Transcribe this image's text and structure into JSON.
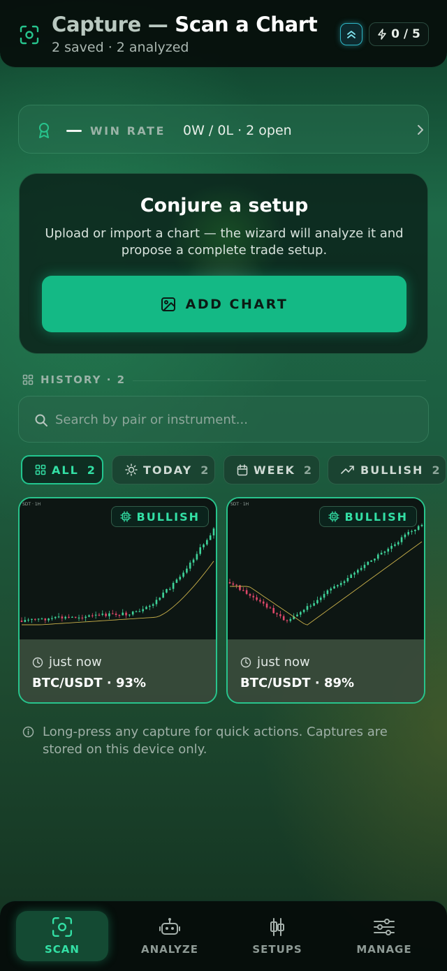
{
  "header": {
    "title_lead": "Capture —",
    "title_main": "Scan a Chart",
    "subtitle": "2 saved · 2 analyzed",
    "credits": "0 / 5",
    "icons": [
      "scan-icon",
      "rank-chevrons-icon",
      "bolt-icon"
    ]
  },
  "winrate": {
    "label": "WIN RATE",
    "value": "0W / 0L · 2 open",
    "icons": [
      "award-icon",
      "chevron-right-icon"
    ]
  },
  "hero": {
    "title": "Conjure a setup",
    "description": "Upload or import a chart — the wizard will analyze it and propose a complete trade setup.",
    "button_label": "ADD CHART"
  },
  "history": {
    "label": "HISTORY · 2",
    "search_placeholder": "Search by pair or instrument..."
  },
  "filters": [
    {
      "label": "ALL",
      "count": "2",
      "icon": "grid-icon",
      "active": true
    },
    {
      "label": "TODAY",
      "count": "2",
      "icon": "sun-icon",
      "active": false
    },
    {
      "label": "WEEK",
      "count": "2",
      "icon": "calendar-icon",
      "active": false
    },
    {
      "label": "BULLISH",
      "count": "2",
      "icon": "trending-up-icon",
      "active": false
    }
  ],
  "captures": [
    {
      "badge": "BULLISH",
      "time": "just now",
      "pair": "BTC/USDT · 93%",
      "mini_label": "SDT · 1H"
    },
    {
      "badge": "BULLISH",
      "time": "just now",
      "pair": "BTC/USDT · 89%",
      "mini_label": "SDT · 1H"
    }
  ],
  "note": "Long-press any capture for quick actions. Captures are stored on this device only.",
  "nav": [
    {
      "label": "SCAN",
      "icon": "scan-icon",
      "active": true
    },
    {
      "label": "ANALYZE",
      "icon": "robot-icon",
      "active": false
    },
    {
      "label": "SETUPS",
      "icon": "candlestick-icon",
      "active": false
    },
    {
      "label": "MANAGE",
      "icon": "sliders-icon",
      "active": false
    }
  ],
  "colors": {
    "accent": "#14b985",
    "accent_text": "#33e0a5",
    "bull_candle": "#3fd39a",
    "bear_candle": "#e0486a"
  }
}
